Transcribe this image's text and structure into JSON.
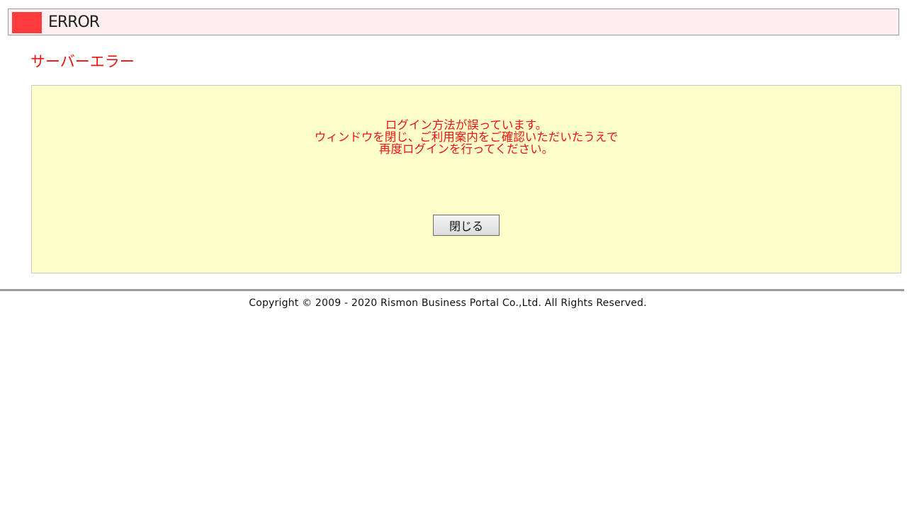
{
  "header": {
    "title": "ERROR",
    "accent_color": "#ff3b3b",
    "background_color": "#fff0f0"
  },
  "page_title": "サーバーエラー",
  "message": {
    "lines": [
      "ログイン方法が誤っています。",
      "ウィンドウを閉じ、ご利用案内をご確認いただいたうえで",
      "再度ログインを行ってください。"
    ],
    "text_color": "#ee1111",
    "box_color": "#ffffcc"
  },
  "buttons": {
    "close_label": "閉じる"
  },
  "footer": {
    "copyright": "Copyright © 2009 - 2020 Rismon Business Portal Co.,Ltd. All Rights Reserved."
  }
}
